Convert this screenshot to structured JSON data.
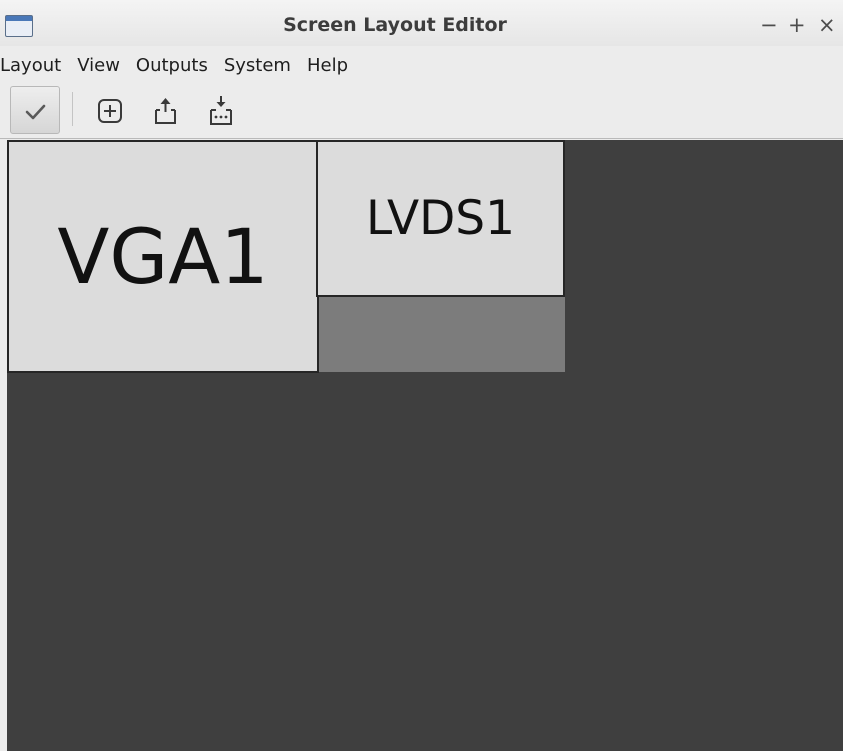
{
  "window": {
    "title": "Screen Layout Editor",
    "app_icon": "window-icon",
    "controls": {
      "minimize": "−",
      "maximize": "+",
      "close": "×"
    }
  },
  "menubar": {
    "items": [
      {
        "label": "Layout"
      },
      {
        "label": "View"
      },
      {
        "label": "Outputs"
      },
      {
        "label": "System"
      },
      {
        "label": "Help"
      }
    ]
  },
  "toolbar": {
    "buttons": [
      {
        "icon": "check-icon",
        "action": "apply",
        "state": "pressed"
      },
      {
        "icon": "add-icon",
        "action": "new"
      },
      {
        "icon": "open-icon",
        "action": "open"
      },
      {
        "icon": "save-as-icon",
        "action": "save-as"
      }
    ]
  },
  "canvas": {
    "background_color": "#3f3f3f",
    "outputs": [
      {
        "name": "VGA1",
        "fill_color": "#dcdcdc"
      },
      {
        "name": "LVDS1",
        "fill_color": "#dcdcdc",
        "overhang_color": "#7c7c7c"
      }
    ]
  }
}
